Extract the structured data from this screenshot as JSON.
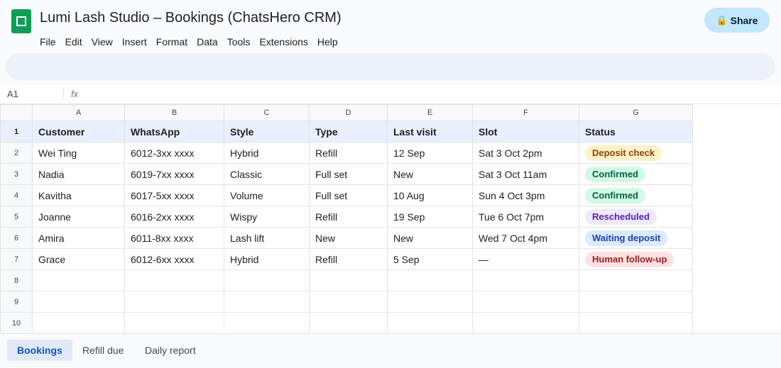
{
  "document": {
    "title": "Lumi Lash Studio – Bookings (ChatsHero CRM)"
  },
  "menu": [
    "File",
    "Edit",
    "View",
    "Insert",
    "Format",
    "Data",
    "Tools",
    "Extensions",
    "Help"
  ],
  "share": {
    "label": "Share",
    "icon": "lock-icon",
    "glyph": "🔒"
  },
  "formula_bar": {
    "cell_ref": "A1",
    "fx": "fx",
    "value": ""
  },
  "grid": {
    "column_letters": [
      "A",
      "B",
      "C",
      "D",
      "E",
      "F",
      "G"
    ],
    "row_numbers": [
      "1",
      "2",
      "3",
      "4",
      "5",
      "6",
      "7",
      "8",
      "9",
      "10"
    ],
    "headers": [
      "Customer",
      "WhatsApp",
      "Style",
      "Type",
      "Last visit",
      "Slot",
      "Status"
    ],
    "rows": [
      [
        "Wei Ting",
        "6012-3xx xxxx",
        "Hybrid",
        "Refill",
        "12 Sep",
        "Sat 3 Oct 2pm",
        "Deposit check"
      ],
      [
        "Nadia",
        "6019-7xx xxxx",
        "Classic",
        "Full set",
        "New",
        "Sat 3 Oct 11am",
        "Confirmed"
      ],
      [
        "Kavitha",
        "6017-5xx xxxx",
        "Volume",
        "Full set",
        "10 Aug",
        "Sun 4 Oct 3pm",
        "Confirmed"
      ],
      [
        "Joanne",
        "6016-2xx xxxx",
        "Wispy",
        "Refill",
        "19 Sep",
        "Tue 6 Oct 7pm",
        "Rescheduled"
      ],
      [
        "Amira",
        "6011-8xx xxxx",
        "Lash lift",
        "New",
        "New",
        "Wed 7 Oct 4pm",
        "Waiting deposit"
      ],
      [
        "Grace",
        "6012-6xx xxxx",
        "Hybrid",
        "Refill",
        "5 Sep",
        "—",
        "Human follow-up"
      ]
    ],
    "status_colors": {
      "Deposit check": {
        "bg": "#fef3c7",
        "fg": "#92400e"
      },
      "Confirmed": {
        "bg": "#d1fae5",
        "fg": "#065f46"
      },
      "Rescheduled": {
        "bg": "#ede9fe",
        "fg": "#5b21b6"
      },
      "Waiting deposit": {
        "bg": "#dbeafe",
        "fg": "#1e40af"
      },
      "Human follow-up": {
        "bg": "#fee2e2",
        "fg": "#991b1b"
      }
    }
  },
  "sheet_tabs": [
    {
      "label": "Bookings",
      "active": true
    },
    {
      "label": "Refill due",
      "active": false
    },
    {
      "label": "Daily report",
      "active": false
    }
  ],
  "colors": {
    "accent": "#0b57d0",
    "share_bg": "#c2e7ff",
    "logo": "#0f9d58"
  }
}
